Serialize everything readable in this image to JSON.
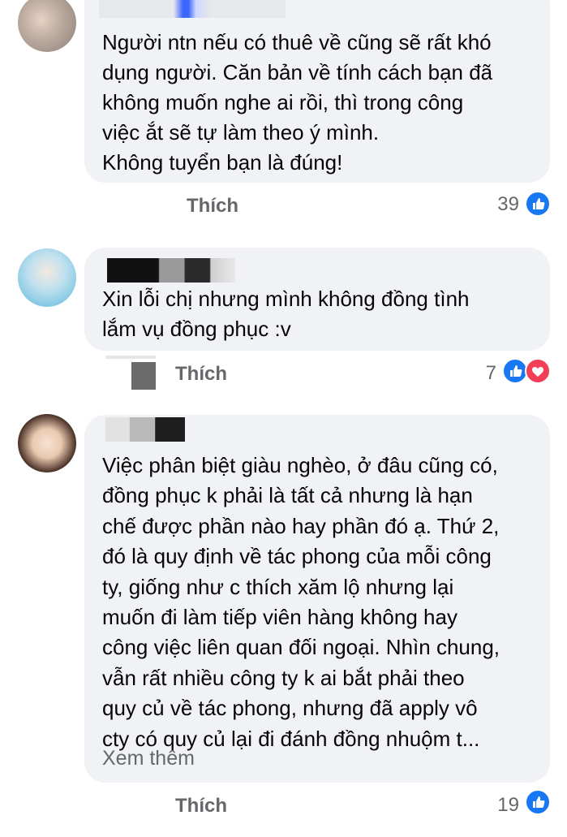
{
  "comments": [
    {
      "text": "Người ntn nếu có thuê về cũng sẽ rất khó\ndụng người. Căn bản về tính cách bạn đã\nkhông muốn nghe ai rồi, thì trong công\nviệc ắt sẽ tự làm theo ý mình.\nKhông tuyển bạn là đúng!",
      "like_label": "Thích",
      "reaction_count": "39",
      "reactions": [
        "like-icon"
      ]
    },
    {
      "text": "Xin lỗi chị nhưng mình không đồng tình\nlắm vụ đồng phục :v",
      "like_label": "Thích",
      "reaction_count": "7",
      "reactions": [
        "like-icon",
        "love-icon"
      ]
    },
    {
      "text": "Việc phân biệt giàu nghèo, ở đâu cũng có,\nđồng phục k phải là tất cả nhưng là hạn\nchế được phần nào hay phần đó ạ. Thứ 2,\nđó là quy định về tác phong của mỗi công\nty, giống như c thích xăm lộ nhưng lại\nmuốn đi làm tiếp viên hàng không hay\ncông việc liên quan đối ngoại. Nhìn chung,\nvẫn rất nhiều công ty k ai bắt phải theo\nquy củ về tác phong, nhưng đã apply vô\ncty có quy củ lại đi đánh đồng nhuộm t...",
      "see_more_label": "Xem thêm",
      "like_label": "Thích",
      "reaction_count": "19",
      "reactions": [
        "like-icon"
      ]
    }
  ],
  "colors": {
    "bubble": "#f0f2f5",
    "secondary_text": "#65676b",
    "like_blue": "#1877f2",
    "love_red": "#f33e58"
  }
}
